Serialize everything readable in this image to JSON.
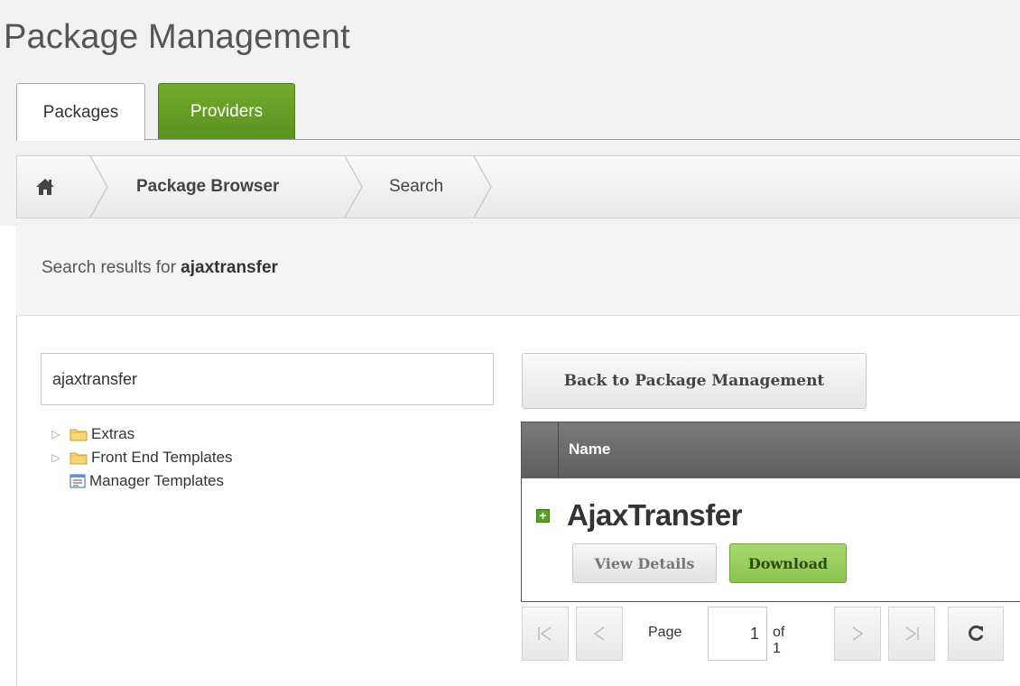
{
  "header": {
    "title": "Package Management"
  },
  "tabs": [
    {
      "label": "Packages",
      "active": true
    },
    {
      "label": "Providers",
      "active": false
    }
  ],
  "breadcrumb": {
    "home_icon": "home-icon",
    "items": [
      "Package Browser",
      "Search"
    ]
  },
  "results": {
    "prefix": "Search results for ",
    "query": "ajaxtransfer"
  },
  "search": {
    "value": "ajaxtransfer"
  },
  "tree": [
    {
      "label": "Extras",
      "icon": "folder-icon",
      "expandable": true
    },
    {
      "label": "Front End Templates",
      "icon": "folder-icon",
      "expandable": true
    },
    {
      "label": "Manager Templates",
      "icon": "template-icon",
      "expandable": false
    }
  ],
  "actions": {
    "back_label": "Back to Package Management"
  },
  "grid": {
    "column_name": "Name",
    "rows": [
      {
        "name": "AjaxTransfer",
        "view_label": "View Details",
        "download_label": "Download"
      }
    ]
  },
  "pager": {
    "page_label": "Page",
    "current": "1",
    "of_label": "of 1"
  },
  "colors": {
    "accent_green": "#6aa127",
    "grid_header": "#6b6b6b",
    "download_green": "#94ca57"
  }
}
